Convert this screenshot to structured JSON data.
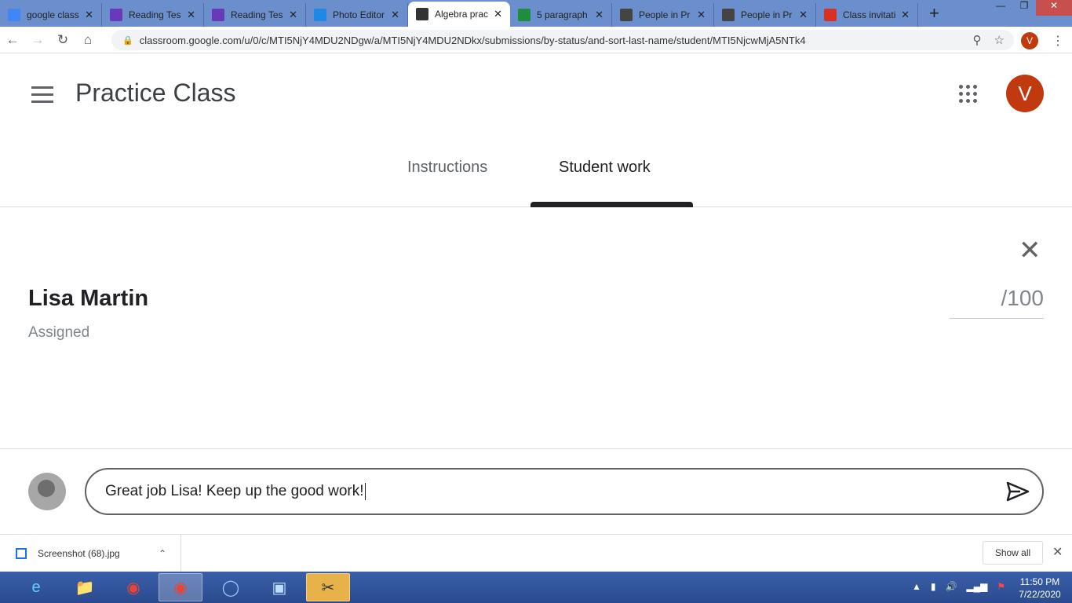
{
  "browser": {
    "tabs": [
      {
        "title": "google class",
        "icon": "docs-icon",
        "color": "#4285f4"
      },
      {
        "title": "Reading Tes",
        "icon": "forms-icon",
        "color": "#673ab7"
      },
      {
        "title": "Reading Tes",
        "icon": "forms-icon",
        "color": "#673ab7"
      },
      {
        "title": "Photo Editor",
        "icon": "photo-editor-icon",
        "color": "#1e88e5"
      },
      {
        "title": "Algebra prac",
        "icon": "classroom-icon",
        "color": "#333333",
        "active": true
      },
      {
        "title": "5 paragraph",
        "icon": "classroom-icon",
        "color": "#1e8e3e"
      },
      {
        "title": "People in Pr",
        "icon": "classroom-icon",
        "color": "#444444"
      },
      {
        "title": "People in Pr",
        "icon": "classroom-icon",
        "color": "#444444"
      },
      {
        "title": "Class invitati",
        "icon": "gmail-icon",
        "color": "#d93025"
      }
    ],
    "url": "classroom.google.com/u/0/c/MTI5NjY4MDU2NDgw/a/MTI5NjY4MDU2NDkx/submissions/by-status/and-sort-last-name/student/MTI5NjcwMjA5NTk4",
    "account_initial": "V"
  },
  "header": {
    "title": "Practice Class",
    "avatar_initial": "V",
    "tabs": [
      "Instructions",
      "Student work"
    ],
    "selected_tab": "Student work"
  },
  "student": {
    "name": "Lisa Martin",
    "status": "Assigned",
    "grade_suffix": "/100"
  },
  "comment": {
    "value": "Great job Lisa! Keep up the good work!"
  },
  "downloads": {
    "file": "Screenshot (68).jpg",
    "show_all": "Show all"
  },
  "taskbar": {
    "time": "11:50 PM",
    "date": "7/22/2020"
  },
  "colors": {
    "accent": "#c1390e",
    "tabbar": "#6b8fcd"
  }
}
